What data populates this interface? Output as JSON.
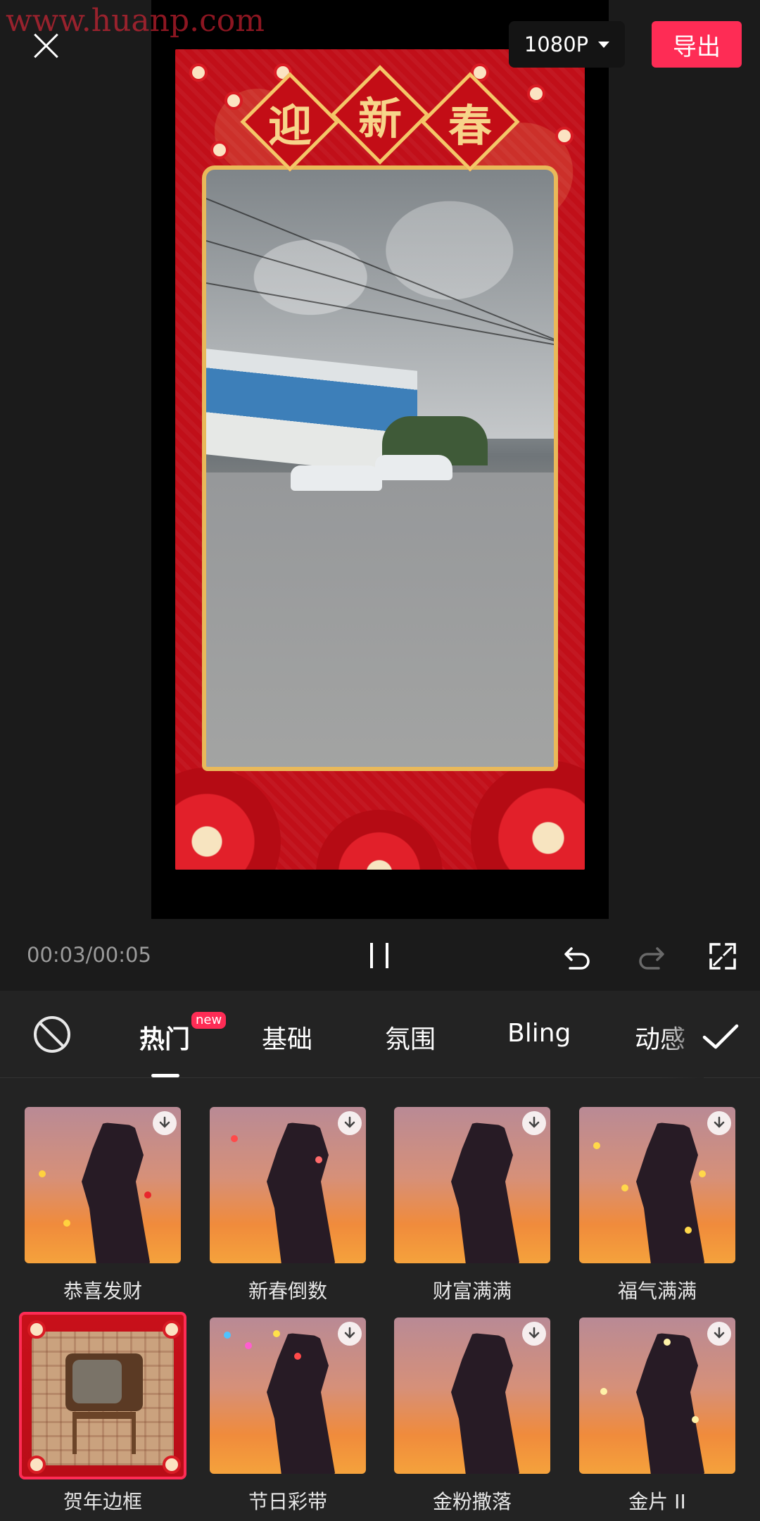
{
  "watermark": "www.huanp.com",
  "top_bar": {
    "close_icon": "close-icon",
    "resolution": "1080P",
    "export_label": "导出"
  },
  "preview": {
    "frame_title_chars": [
      "迎",
      "新",
      "春"
    ],
    "frame_color": "#c8101a"
  },
  "playback": {
    "time": "00:03/00:05",
    "icons": [
      "pause-icon",
      "undo-icon",
      "redo-icon",
      "fullscreen-icon"
    ]
  },
  "panel": {
    "tabs": [
      {
        "label": "热门",
        "active": true,
        "badge": "new"
      },
      {
        "label": "基础",
        "active": false
      },
      {
        "label": "氛围",
        "active": false
      },
      {
        "label": "Bling",
        "active": false
      },
      {
        "label": "动感",
        "active": false
      }
    ],
    "effects": [
      {
        "label": "恭喜发财",
        "download": true,
        "selected": false
      },
      {
        "label": "新春倒数",
        "download": true,
        "selected": false
      },
      {
        "label": "财富满满",
        "download": true,
        "selected": false
      },
      {
        "label": "福气满满",
        "download": true,
        "selected": false
      },
      {
        "label": "贺年边框",
        "download": false,
        "selected": true
      },
      {
        "label": "节日彩带",
        "download": true,
        "selected": false
      },
      {
        "label": "金粉撒落",
        "download": true,
        "selected": false
      },
      {
        "label": "金片 II",
        "download": true,
        "selected": false
      }
    ]
  },
  "colors": {
    "accent": "#fe2c55",
    "panel_bg": "#232323",
    "app_bg": "#1b1b1b"
  }
}
